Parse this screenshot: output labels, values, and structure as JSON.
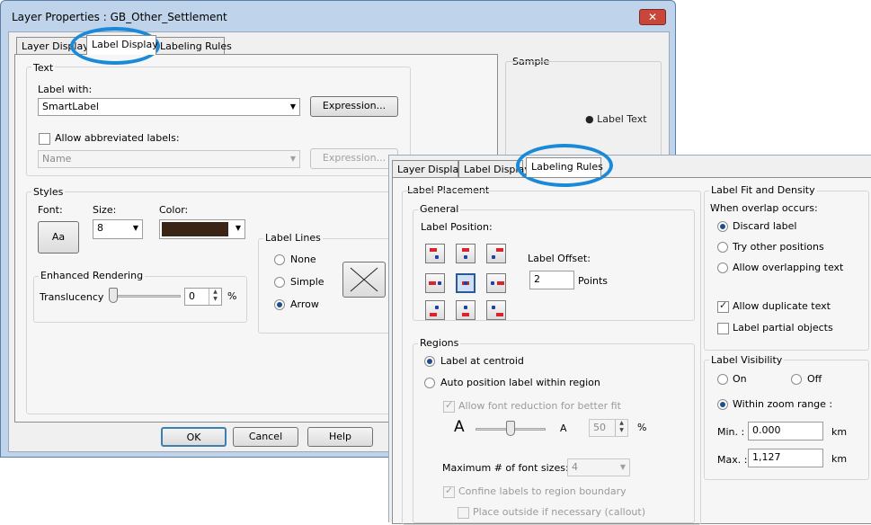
{
  "window": {
    "title": "Layer Properties : GB_Other_Settlement",
    "close_glyph": "✕"
  },
  "tabs": [
    "Layer Display",
    "Label Display",
    "Labeling Rules"
  ],
  "text_group": {
    "title": "Text",
    "label_with": "Label with:",
    "label_with_value": "SmartLabel",
    "expression_btn": "Expression...",
    "allow_abbrev": "Allow abbreviated labels:",
    "abbrev_value": "Name",
    "expression_btn_disabled": "Expression..."
  },
  "styles": {
    "title": "Styles",
    "font_label": "Font:",
    "font_btn": "Aa",
    "size_label": "Size:",
    "size_value": "8",
    "color_label": "Color:",
    "color_value": "#3a2416",
    "enhanced": "Enhanced Rendering",
    "translucency": "Translucency",
    "translucency_value": "0",
    "percent": "%",
    "translucency_fraction": 0.0
  },
  "label_lines": {
    "title": "Label Lines",
    "none": "None",
    "simple": "Simple",
    "arrow": "Arrow"
  },
  "sample": {
    "title": "Sample",
    "text": "Label Text"
  },
  "footer": {
    "ok": "OK",
    "cancel": "Cancel",
    "help": "Help"
  },
  "rules_tabs": [
    "Layer Display",
    "Label Display",
    "Labeling Rules"
  ],
  "placement": {
    "title": "Label Placement",
    "general": "General",
    "label_position": "Label Position:",
    "label_offset": "Label Offset:",
    "offset_value": "2",
    "points": "Points",
    "regions": "Regions",
    "at_centroid": "Label at centroid",
    "auto_position": "Auto position label within region",
    "allow_font_reduction": "Allow font reduction for better fit",
    "big_a": "A",
    "small_a": "A",
    "reduction_value": "50",
    "percent": "%",
    "max_font_sizes": "Maximum # of font sizes:",
    "max_font_value": "4",
    "confine": "Confine labels to region boundary",
    "place_outside": "Place outside if necessary (callout)"
  },
  "fit": {
    "title": "Label Fit and Density",
    "when_overlap": "When overlap occurs:",
    "discard": "Discard label",
    "try_other": "Try other positions",
    "allow_overlap": "Allow overlapping text",
    "allow_dup": "Allow duplicate text",
    "partial": "Label partial objects"
  },
  "visibility": {
    "title": "Label Visibility",
    "on": "On",
    "off": "Off",
    "within_zoom": "Within zoom range :",
    "min_label": "Min. :",
    "min_value": "0.000",
    "max_label": "Max. :",
    "max_value": "1,127",
    "unit": "km",
    "unit2": "km"
  },
  "colors": {
    "highlight": "#1a8ad8",
    "accent": "#1f4e8c",
    "marker_red": "#d9232e",
    "marker_blue": "#2140a8"
  }
}
